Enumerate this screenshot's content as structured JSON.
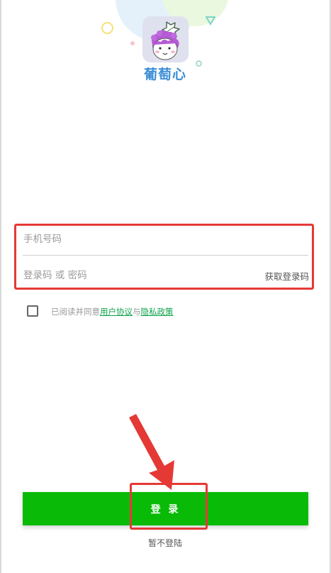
{
  "app": {
    "name": "葡萄心",
    "logo_icon": "grape-heart-logo-icon"
  },
  "form": {
    "phone_placeholder": "手机号码",
    "phone_value": "",
    "code_placeholder": "登录码 或 密码",
    "code_value": "",
    "get_code_label": "获取登录码"
  },
  "agreement": {
    "checked": false,
    "prefix": "已阅读并同意",
    "user_agreement": "用户协议",
    "connector": "与",
    "privacy_policy": "隐私政策"
  },
  "actions": {
    "login_label": "登 录",
    "skip_label": "暂不登陆"
  },
  "colors": {
    "primary_green": "#09bb07",
    "link_green": "#0ca34a",
    "highlight_red": "#e53935",
    "logo_blue": "#3d8ed6"
  }
}
